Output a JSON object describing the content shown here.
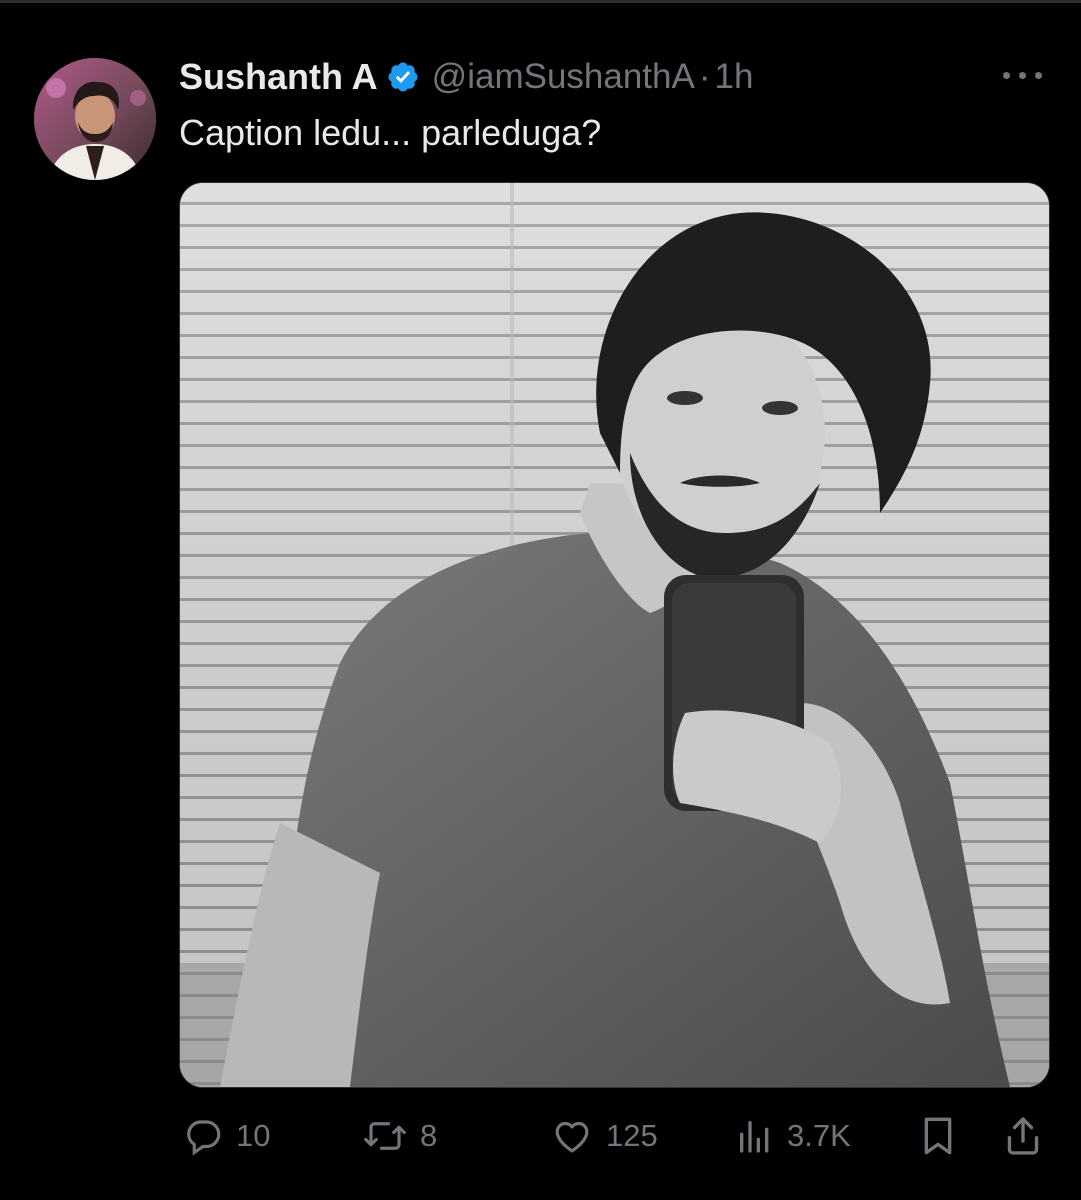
{
  "tweet": {
    "author": {
      "display_name": "Sushanth A",
      "verified": true,
      "handle": "@iamSushanthA",
      "separator": "·",
      "time": "1h",
      "avatar": "profile-photo"
    },
    "text": "Caption ledu... parleduga?",
    "media": {
      "type": "photo",
      "description_icon": "grayscale-mirror-selfie-photo"
    },
    "actions": {
      "replies": "10",
      "retweets": "8",
      "likes": "125",
      "views": "3.7K"
    }
  },
  "icons": {
    "more": "more-horizontal-icon",
    "reply": "reply-icon",
    "retweet": "retweet-icon",
    "like": "heart-icon",
    "views": "analytics-icon",
    "bookmark": "bookmark-icon",
    "share": "share-icon",
    "verified": "verified-badge-icon"
  },
  "colors": {
    "background": "#000000",
    "primary_text": "#e7e9ea",
    "secondary_text": "#71767b",
    "verified_blue": "#1d9bf0",
    "border": "#2f3336"
  }
}
